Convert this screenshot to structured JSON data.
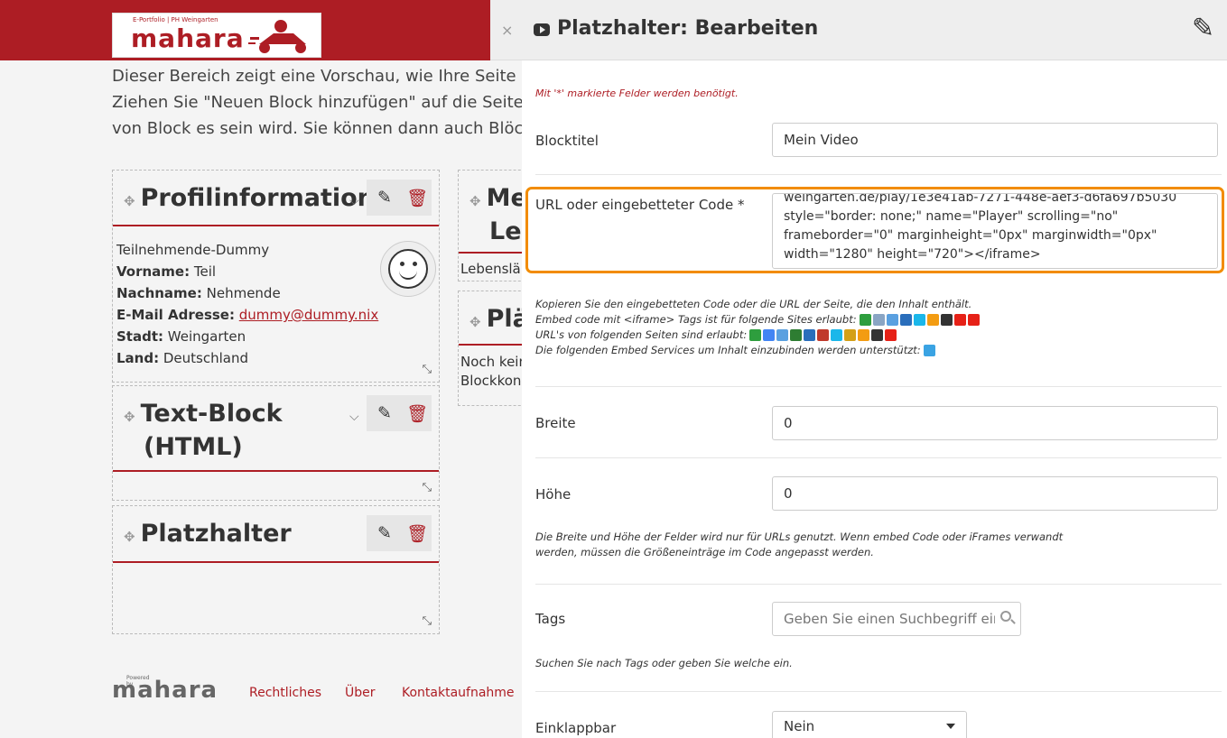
{
  "header": {
    "logo_subtitle": "E-Portfolio | PH Weingarten",
    "logo_word": "mahara"
  },
  "intro": {
    "lines": [
      "Dieser Bereich zeigt eine Vorschau, wie Ihre Seite a",
      "Ziehen Sie \"Neuen Block hinzufügen\" auf die Seite,",
      "von Block es sein wird. Sie können dann auch Blöc"
    ]
  },
  "blocks": {
    "profile": {
      "title": "Profilinformation",
      "name_line": "Teilnehmende-Dummy",
      "fields": [
        {
          "label": "Vorname:",
          "value": " Teil"
        },
        {
          "label": "Nachname:",
          "value": " Nehmende"
        },
        {
          "label": "E-Mail Adresse:",
          "value": "dummy@dummy.nix"
        },
        {
          "label": "Stadt:",
          "value": " Weingarten"
        },
        {
          "label": "Land:",
          "value": " Deutschland"
        }
      ]
    },
    "text_block": {
      "title_line1": "Text-Block",
      "title_line2": "(HTML)"
    },
    "placeholder": {
      "title": "Platzhalter"
    },
    "mid1": {
      "title_line1": "Me",
      "title_line2": "Le",
      "body": "Lebenslä"
    },
    "mid2": {
      "title": "Plä",
      "body_line1": "Noch kein",
      "body_line2": "Blockkon"
    }
  },
  "footer": {
    "powered_by": "Powered by",
    "logo": "mahara",
    "links": [
      "Rechtliches",
      "Über",
      "Kontaktaufnahme"
    ]
  },
  "panel": {
    "close": "×",
    "title": "Platzhalter: Bearbeiten",
    "required_note": "Mit '*' markierte Felder werden benötigt.",
    "blocktitle": {
      "label": "Blocktitel",
      "value": "Mein Video"
    },
    "url": {
      "label": "URL oder eingebetteter Code *",
      "lines": [
        "weingarten.de/play/1e3e41ab-7271-448e-aef3-d6fa697b5030",
        "style=\"border: none;\" name=\"Player\" scrolling=\"no\"",
        "frameborder=\"0\" marginheight=\"0px\" marginwidth=\"0px\"",
        "width=\"1280\" height=\"720\"></iframe>"
      ]
    },
    "url_help": [
      "Kopieren Sie den eingebetteten Code oder die URL der Seite, die den Inhalt enthält.",
      "Embed code mit <iframe> Tags ist für folgende Sites erlaubt:",
      "URL's von folgenden Seiten sind erlaubt:",
      "Die folgenden Embed Services um Inhalt einzubinden werden unterstützt:"
    ],
    "width": {
      "label": "Breite",
      "value": "0"
    },
    "height": {
      "label": "Höhe",
      "value": "0"
    },
    "size_help": [
      "Die Breite und Höhe der Felder wird nur für URLs genutzt. Wenn embed Code oder iFrames verwandt",
      "werden, müssen die Größeneinträge im Code angepasst werden."
    ],
    "tags": {
      "label": "Tags",
      "placeholder": "Geben Sie einen Suchbegriff ein",
      "help": "Suchen Sie nach Tags oder geben Sie welche ein."
    },
    "collapsible": {
      "label": "Einklappbar",
      "value": "Nein"
    }
  },
  "colors": {
    "brand": "#ad1d24",
    "highlight": "#f28c00"
  },
  "service_icons_iframe": [
    "#2e9e3e",
    "#8aa5c4",
    "#5aa0e0",
    "#2a6ebb",
    "#1ab7ea",
    "#f39c12",
    "#333333",
    "#e62117",
    "#e62117"
  ],
  "service_icons_url": [
    "#2e9e3e",
    "#4285f4",
    "#5aa0e0",
    "#2e7d32",
    "#2a6ebb",
    "#c0392b",
    "#1ab7ea",
    "#d4a017",
    "#f39c12",
    "#333333",
    "#e62117"
  ],
  "service_icons_embed": [
    "#3aa3e3"
  ]
}
